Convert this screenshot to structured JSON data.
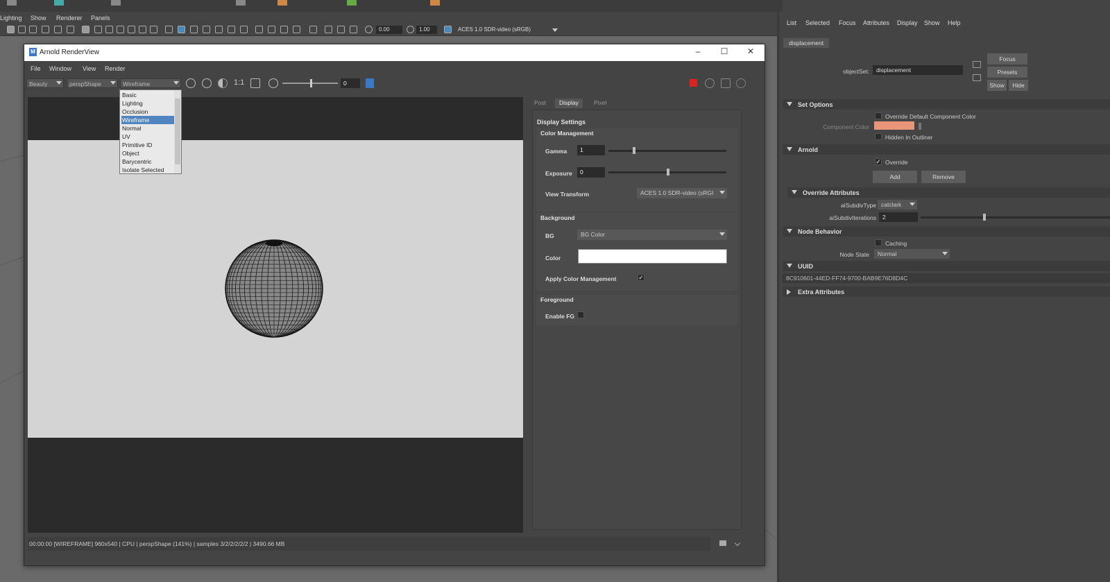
{
  "main_menu": [
    "Lighting",
    "Show",
    "Renderer",
    "Panels"
  ],
  "viewport_toolbar": {
    "value1": "0.00",
    "value2": "1.00",
    "colorspace": "ACES 1.0 SDR-video (sRGB)"
  },
  "renderview": {
    "title": "Arnold RenderView",
    "menu": [
      "File",
      "Window",
      "View",
      "Render"
    ],
    "aov": "Beauty",
    "camera": "perspShape",
    "mode": "Wireframe",
    "ratio_label": "1:1",
    "exposure_field": "0",
    "dropdown_options": [
      "Basic",
      "Lighting",
      "Occlusion",
      "Wireframe",
      "Normal",
      "UV",
      "Primitive ID",
      "Object",
      "Barycentric",
      "Isolate Selected"
    ],
    "dropdown_selected": "Wireframe",
    "tabs": [
      "Post",
      "Display",
      "Pixel"
    ],
    "active_tab": "Display",
    "display": {
      "title": "Display Settings",
      "color_mgmt_header": "Color Management",
      "gamma_label": "Gamma",
      "gamma": "1",
      "exposure_label": "Exposure",
      "exposure": "0",
      "view_transform_label": "View Transform",
      "view_transform": "ACES 1.0 SDR-video (sRGI",
      "background_header": "Background",
      "bg_label": "BG",
      "bg": "BG Color",
      "color_label": "Color",
      "apply_cm_label": "Apply Color Management",
      "foreground_header": "Foreground",
      "enable_fg_label": "Enable FG"
    },
    "status": "00:00:00 [WIREFRAME] 960x540 | CPU | perspShape (141%) | samples 3/2/2/2/2/2 | 3490.66 MB"
  },
  "attribute_editor": {
    "menu": [
      "List",
      "Selected",
      "Focus",
      "Attributes",
      "Display",
      "Show",
      "Help"
    ],
    "tab": "displacement",
    "objectset_label": "objectSet:",
    "objectset_value": "displacement",
    "buttons": {
      "focus": "Focus",
      "presets": "Presets",
      "show": "Show",
      "hide": "Hide"
    },
    "sections": {
      "set_options": "Set Options",
      "override_default": "Override Default Component Color",
      "component_color": "Component Color",
      "hidden_outliner": "Hidden In Outliner",
      "arnold": "Arnold",
      "override": "Override",
      "add": "Add",
      "remove": "Remove",
      "override_attributes": "Override Attributes",
      "subdiv_type_label": "aiSubdivType",
      "subdiv_type": "catclark",
      "subdiv_iter_label": "aiSubdivIterations",
      "subdiv_iter": "2",
      "node_behavior": "Node Behavior",
      "caching": "Caching",
      "node_state_label": "Node State",
      "node_state": "Normal",
      "uuid_header": "UUID",
      "uuid": "8C910601-44ED-FF74-9700-BAB9E76D8D4C",
      "extra": "Extra Attributes"
    }
  },
  "colors": {
    "selection": "#5185bf",
    "component_color": "#e8957a",
    "render_bg": "#d4d4d4",
    "stop_red": "#d22"
  }
}
